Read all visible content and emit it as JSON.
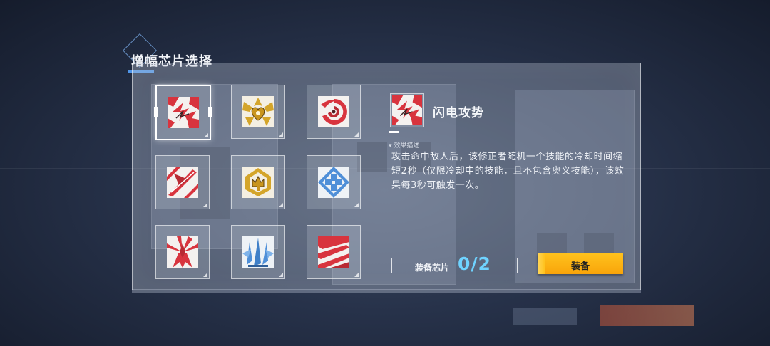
{
  "dialog": {
    "title": "增幅芯片选择"
  },
  "chips": [
    {
      "icon": "lightning-strike-chip-icon",
      "selected": true
    },
    {
      "icon": "golden-heart-chip-icon",
      "selected": false
    },
    {
      "icon": "red-vortex-chip-icon",
      "selected": false
    },
    {
      "icon": "red-slash-chip-icon",
      "selected": false
    },
    {
      "icon": "golden-crown-chip-icon",
      "selected": false
    },
    {
      "icon": "blue-cross-chip-icon",
      "selected": false
    },
    {
      "icon": "red-burst-chip-icon",
      "selected": false
    },
    {
      "icon": "blue-claw-chip-icon",
      "selected": false
    },
    {
      "icon": "red-wave-chip-icon",
      "selected": false
    }
  ],
  "detail": {
    "name": "闪电攻势",
    "effect_label": "▾ 效果描述",
    "description": "攻击命中敌人后，该修正者随机一个技能的冷却时间缩短2秒（仅限冷却中的技能，且不包含奥义技能），该效果每3秒可触发一次。"
  },
  "equip": {
    "label": "装备芯片",
    "count": "0/2",
    "button_label": "装备"
  },
  "colors": {
    "accent_blue": "#6fd3ff",
    "button_orange": "#f9a40a",
    "chip_red": "#d8343e",
    "chip_gold": "#d4a52a",
    "chip_blue": "#4f8fd8"
  }
}
